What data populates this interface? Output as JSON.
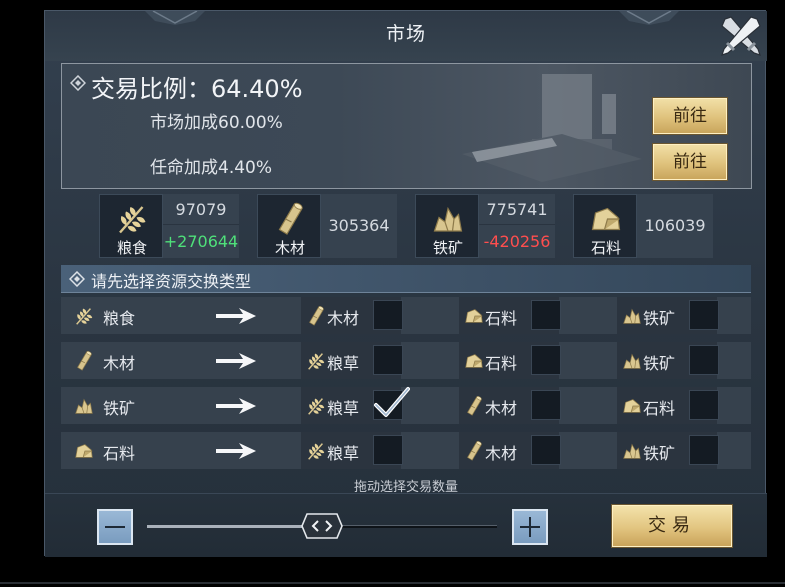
{
  "window": {
    "title": "市场",
    "close_icon": "crossed-swords-close-icon"
  },
  "colors": {
    "gain": "#4fe07a",
    "loss": "#ff4e4e",
    "gold_button": "#dfc27c",
    "panel": "#2f3b48"
  },
  "ratio": {
    "title": "交易比例：64.40%",
    "market_bonus": "市场加成60.00%",
    "appoint_bonus": "任命加成4.40%",
    "goto_label_1": "前往",
    "goto_label_2": "前往"
  },
  "resources": [
    {
      "name": "粮食",
      "icon": "wheat-icon",
      "amount": "97079",
      "change": "+270644",
      "change_type": "gain"
    },
    {
      "name": "木材",
      "icon": "wood-log-icon",
      "amount": "305364",
      "change": "",
      "change_type": ""
    },
    {
      "name": "铁矿",
      "icon": "iron-ore-icon",
      "amount": "775741",
      "change": "-420256",
      "change_type": "loss"
    },
    {
      "name": "石料",
      "icon": "stone-icon",
      "amount": "106039",
      "change": "",
      "change_type": ""
    }
  ],
  "exchange": {
    "section_title": "请先选择资源交换类型",
    "rows": [
      {
        "source": "粮食",
        "source_icon": "wheat-icon",
        "targets": [
          {
            "label": "木材",
            "icon": "wood-log-icon",
            "checked": false
          },
          {
            "label": "石料",
            "icon": "stone-icon",
            "checked": false
          },
          {
            "label": "铁矿",
            "icon": "iron-ore-icon",
            "checked": false
          }
        ]
      },
      {
        "source": "木材",
        "source_icon": "wood-log-icon",
        "targets": [
          {
            "label": "粮草",
            "icon": "wheat-icon",
            "checked": false
          },
          {
            "label": "石料",
            "icon": "stone-icon",
            "checked": false
          },
          {
            "label": "铁矿",
            "icon": "iron-ore-icon",
            "checked": false
          }
        ]
      },
      {
        "source": "铁矿",
        "source_icon": "iron-ore-icon",
        "targets": [
          {
            "label": "粮草",
            "icon": "wheat-icon",
            "checked": true
          },
          {
            "label": "木材",
            "icon": "wood-log-icon",
            "checked": false
          },
          {
            "label": "石料",
            "icon": "stone-icon",
            "checked": false
          }
        ]
      },
      {
        "source": "石料",
        "source_icon": "stone-icon",
        "targets": [
          {
            "label": "粮草",
            "icon": "wheat-icon",
            "checked": false
          },
          {
            "label": "木材",
            "icon": "wood-log-icon",
            "checked": false
          },
          {
            "label": "铁矿",
            "icon": "iron-ore-icon",
            "checked": false
          }
        ]
      }
    ]
  },
  "quantity": {
    "hint": "拖动选择交易数量",
    "slider_fraction": 0.5,
    "trade_label": "交易"
  }
}
